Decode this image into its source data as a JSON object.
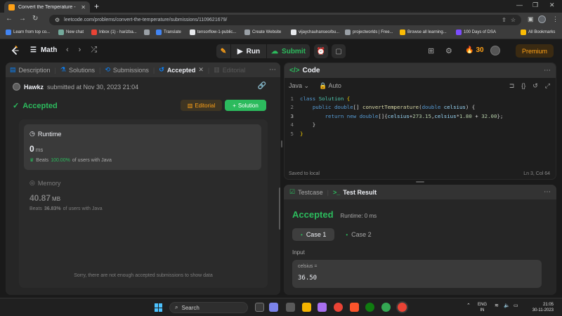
{
  "browser": {
    "tab_title": "Convert the Temperature - Leetc",
    "url": "leetcode.com/problems/convert-the-temperature/submissions/1109621679/",
    "bookmarks": [
      {
        "label": "Learn from top co...",
        "color": "#4285f4"
      },
      {
        "label": "New chat",
        "color": "#74aa9c"
      },
      {
        "label": "Inbox (1) - harizba...",
        "color": "#ea4335"
      },
      {
        "label": "",
        "color": "#9aa0a6"
      },
      {
        "label": "Translate",
        "color": "#4285f4"
      },
      {
        "label": "tensorflow-1-public...",
        "color": "#e8eaed"
      },
      {
        "label": "Create Website",
        "color": "#9aa0a6"
      },
      {
        "label": "vijaychauhanseo/bu...",
        "color": "#e8eaed"
      },
      {
        "label": "projectworlds | Free...",
        "color": "#9aa0a6"
      },
      {
        "label": "Browse all learning...",
        "color": "#fbbc05"
      },
      {
        "label": "100 Days of DSA",
        "color": "#7c4dff"
      },
      {
        "label": "All Bookmarks",
        "color": "#fbbc05"
      }
    ]
  },
  "navbar": {
    "problem_list": "Math",
    "run_label": "Run",
    "submit_label": "Submit",
    "streak": "30",
    "premium_label": "Premium"
  },
  "left_panel": {
    "tabs": {
      "description": "Description",
      "solutions": "Solutions",
      "submissions": "Submissions",
      "accepted": "Accepted",
      "editorial": "Editorial"
    },
    "submission": {
      "user": "Hawkz",
      "submitted_text": "submitted at Nov 30, 2023 21:04"
    },
    "status": "Accepted",
    "editorial_btn": "Editorial",
    "solution_btn": "Solution",
    "runtime": {
      "title": "Runtime",
      "value": "0",
      "unit": "ms",
      "beats_prefix": "Beats",
      "beats_pct": "100.00%",
      "beats_suffix": "of users with Java"
    },
    "memory": {
      "title": "Memory",
      "value": "40.87",
      "unit": "MB",
      "beats_prefix": "Beats",
      "beats_pct": "36.83%",
      "beats_suffix": "of users with Java"
    },
    "empty_message": "Sorry, there are not enough accepted submissions to show data"
  },
  "code_panel": {
    "title": "Code",
    "language": "Java",
    "mode": "Auto",
    "line_numbers": [
      "1",
      "2",
      "3",
      "4",
      "5"
    ],
    "status": "Saved to local",
    "cursor_pos": "Ln 3, Col 64"
  },
  "result_panel": {
    "tab_testcase": "Testcase",
    "tab_result": "Test Result",
    "status": "Accepted",
    "runtime": "Runtime: 0 ms",
    "case1": "Case 1",
    "case2": "Case 2",
    "input_label": "Input",
    "var_name": "celsius =",
    "var_value": "36.50"
  },
  "taskbar": {
    "search_label": "Search",
    "lang_top": "ENG",
    "lang_bottom": "IN",
    "time": "21:05",
    "date": "30-11-2023"
  }
}
